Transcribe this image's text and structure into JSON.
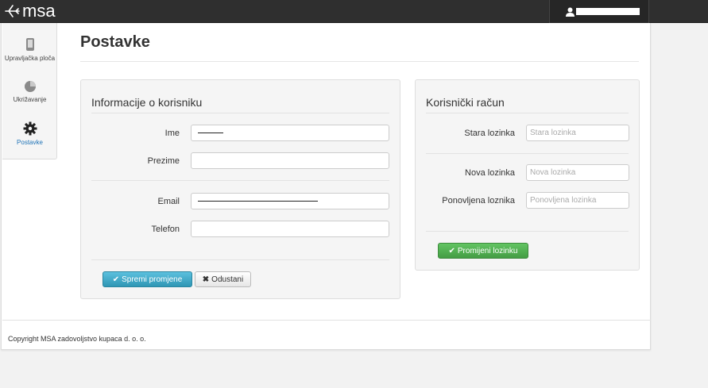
{
  "app": {
    "logo_text": "msa",
    "user_name": "████████"
  },
  "sidebar": {
    "items": [
      {
        "label": "Upravljačka ploča",
        "icon": "phone-icon",
        "active": false
      },
      {
        "label": "Ukrižavanje",
        "icon": "pie-chart-icon",
        "active": false
      },
      {
        "label": "Postavke",
        "icon": "gear-icon",
        "active": true
      }
    ]
  },
  "page": {
    "title": "Postavke"
  },
  "user_info": {
    "legend": "Informacije o korisniku",
    "fields": {
      "ime": {
        "label": "Ime",
        "value": ""
      },
      "prezime": {
        "label": "Prezime",
        "value": ""
      },
      "email": {
        "label": "Email",
        "value": ""
      },
      "telefon": {
        "label": "Telefon",
        "value": ""
      }
    },
    "save_label": "Spremi promjene",
    "cancel_label": "Odustani"
  },
  "account": {
    "legend": "Korisnički račun",
    "fields": {
      "old": {
        "label": "Stara lozinka",
        "placeholder": "Stara lozinka"
      },
      "new": {
        "label": "Nova lozinka",
        "placeholder": "Nova lozinka"
      },
      "repeat": {
        "label": "Ponovljena loznika",
        "placeholder": "Ponovljena lozinka"
      }
    },
    "change_label": "Promijeni lozinku"
  },
  "footer": {
    "copyright": "Copyright MSA zadovoljstvo kupaca d. o. o."
  },
  "colors": {
    "topbar": "#2f2f2f",
    "active_nav": "#1f73b7",
    "info_button": "#49afcd",
    "success_button": "#51a351"
  }
}
